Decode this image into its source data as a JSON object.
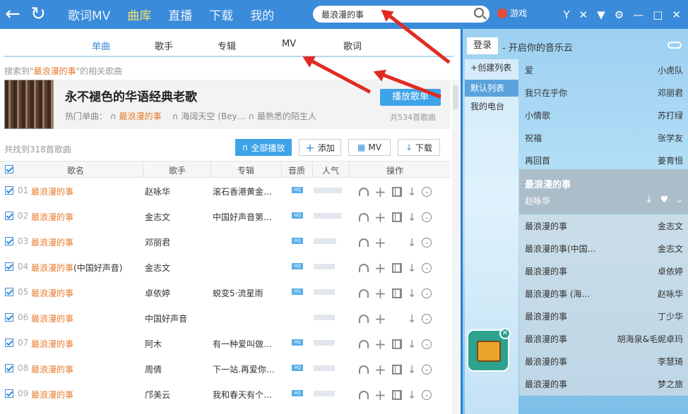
{
  "topbar": {
    "tabs": [
      "歌词MV",
      "曲库",
      "直播",
      "下载",
      "我的"
    ],
    "active_tab": "曲库",
    "search_value": "最浪漫的事",
    "game_label": "游戏"
  },
  "subtabs": [
    "单曲",
    "歌手",
    "专辑",
    "MV",
    "歌词"
  ],
  "search_hint": {
    "prefix": "搜索到\"",
    "keyword": "最浪漫的事",
    "suffix": "\"的相关歌曲"
  },
  "banner": {
    "title": "永不褪色的华语经典老歌",
    "hot_label": "热门单曲：",
    "hot_song1": "最浪漫的事",
    "hot_song2": "海阔天空 (Bey…",
    "hot_song3": "最熟悉的陌生人",
    "play_button": "播放歌单",
    "count": "共534首歌曲"
  },
  "toolbar": {
    "total": "共找到318首歌曲",
    "play_all": "全部播放",
    "add": "添加",
    "mv": "MV",
    "download": "下载"
  },
  "table": {
    "headers": [
      "歌名",
      "歌手",
      "专辑",
      "音质",
      "人气",
      "操作"
    ],
    "rows": [
      {
        "num": "01",
        "name": "最浪漫的事",
        "suffix": "",
        "artist": "赵咏华",
        "album": "滚石香港黄金…",
        "hq": true,
        "pop": 1.0,
        "ops": "full"
      },
      {
        "num": "02",
        "name": "最浪漫的事",
        "suffix": "",
        "artist": "金志文",
        "album": "中国好声音第…",
        "hq": true,
        "pop": 1.0,
        "ops": "full"
      },
      {
        "num": "03",
        "name": "最浪漫的事",
        "suffix": "",
        "artist": "邓丽君",
        "album": "",
        "hq": true,
        "pop": 0.8,
        "ops": "partial"
      },
      {
        "num": "04",
        "name": "最浪漫的事",
        "suffix": "(中国好声音)",
        "artist": "金志文",
        "album": "",
        "hq": true,
        "pop": 0.75,
        "ops": "full"
      },
      {
        "num": "05",
        "name": "最浪漫的事",
        "suffix": "",
        "artist": "卓依婷",
        "album": "蜕变5·流星雨",
        "hq": true,
        "pop": 0.75,
        "ops": "full"
      },
      {
        "num": "06",
        "name": "最浪漫的事",
        "suffix": "",
        "artist": "中国好声音",
        "album": "",
        "hq": false,
        "pop": 0.75,
        "ops": "partial"
      },
      {
        "num": "07",
        "name": "最浪漫的事",
        "suffix": "",
        "artist": "阿木",
        "album": "有一种爱叫做…",
        "hq": true,
        "pop": 0.75,
        "ops": "full"
      },
      {
        "num": "08",
        "name": "最浪漫的事",
        "suffix": "",
        "artist": "周倩",
        "album": "下一站.再爱你…",
        "hq": true,
        "pop": 0.75,
        "ops": "full"
      },
      {
        "num": "09",
        "name": "最浪漫的事",
        "suffix": "",
        "artist": "邝美云",
        "album": "我和春天有个…",
        "hq": true,
        "pop": 0.75,
        "ops": "full"
      }
    ]
  },
  "right": {
    "login": "登录",
    "cloud_text": "- 开启你的音乐云",
    "nav": [
      "创建列表",
      "默认列表",
      "我的电台"
    ],
    "list": [
      {
        "name": "爱",
        "artist": "小虎队"
      },
      {
        "name": "我只在乎你",
        "artist": "邓丽君"
      },
      {
        "name": "小情歌",
        "artist": "苏打绿"
      },
      {
        "name": "祝福",
        "artist": "张学友"
      },
      {
        "name": "再回首",
        "artist": "姜育恒"
      }
    ],
    "now_playing": {
      "title": "最浪漫的事",
      "artist": "赵咏华"
    },
    "list2": [
      {
        "name": "最浪漫的事",
        "artist": "金志文"
      },
      {
        "name": "最浪漫的事(中国…",
        "artist": "金志文"
      },
      {
        "name": "最浪漫的事",
        "artist": "卓依婷"
      },
      {
        "name": "最浪漫的事 (海…",
        "artist": "赵咏华"
      },
      {
        "name": "最浪漫的事",
        "artist": "丁少华"
      },
      {
        "name": "最浪漫的事",
        "artist": "胡海泉&毛妮卓玛"
      },
      {
        "name": "最浪漫的事",
        "artist": "李慧琦"
      },
      {
        "name": "最浪漫的事",
        "artist": "梦之旅"
      }
    ]
  },
  "colors": {
    "topbar": "#3a8bd9",
    "accent_orange": "#e87b2c",
    "active_yellow": "#f7e36a",
    "arrow_red": "#e02b23"
  }
}
